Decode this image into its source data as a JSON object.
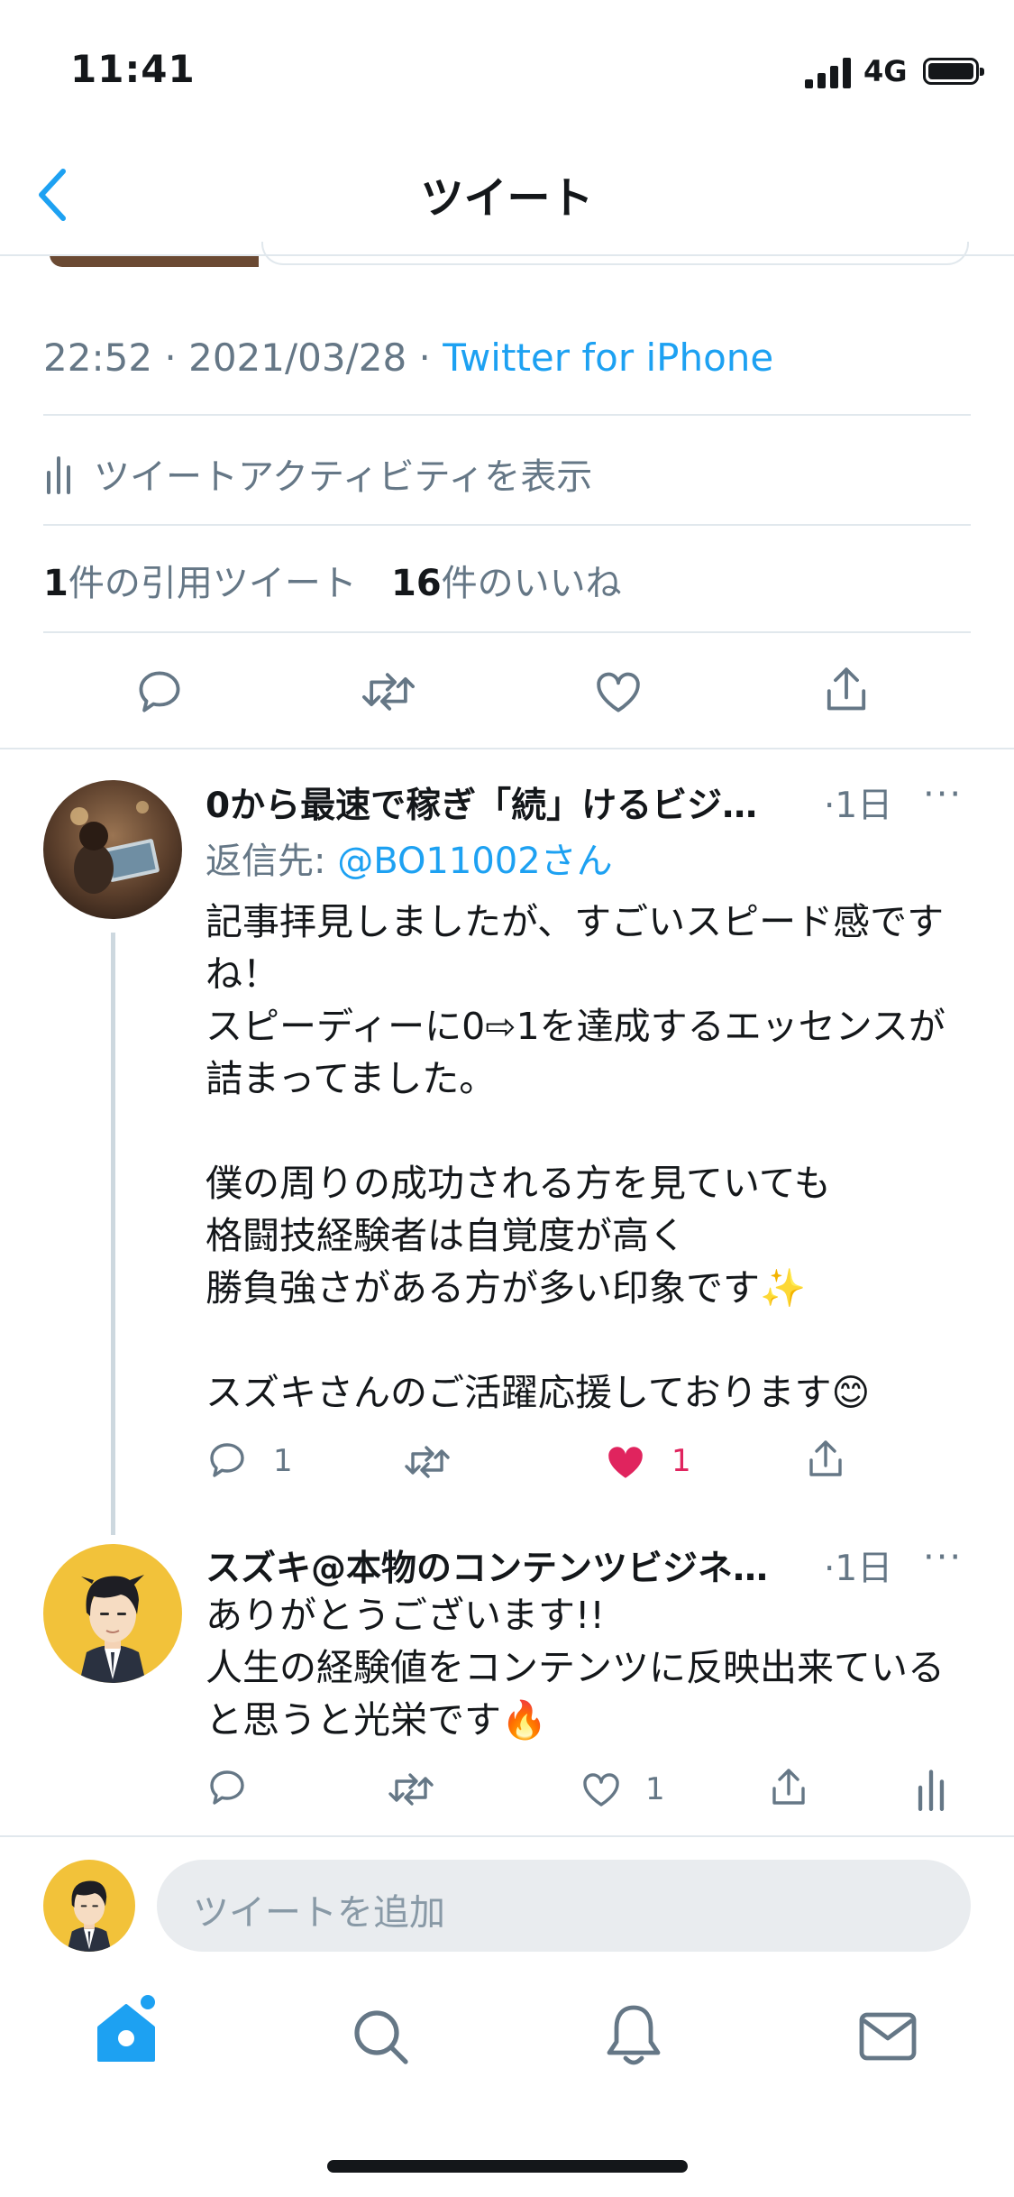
{
  "status_bar": {
    "time": "11:41",
    "network": "4G"
  },
  "nav": {
    "title": "ツイート"
  },
  "tweet_meta": {
    "time": "22:52",
    "sep1": " · ",
    "date": "2021/03/28",
    "sep2": " · ",
    "client": "Twitter for iPhone"
  },
  "activity": {
    "label": "ツイートアクティビティを表示"
  },
  "stats": {
    "quote_count": "1",
    "quote_label": "件の引用ツイート",
    "like_count": "16",
    "like_label": "件のいいね"
  },
  "replies": [
    {
      "name": "0から最速で稼ぎ「続」けるビジ…",
      "date": "·1日",
      "more": "···",
      "reply_prefix": "返信先: ",
      "reply_handle": "@BO11002さん",
      "text": "記事拝見しましたが、すごいスピード感ですね！\nスピーディーに0⇨1を達成するエッセンスが詰まってました。\n\n僕の周りの成功される方を見ていても\n格闘技経験者は自覚度が高く\n勝負強さがある方が多い印象です✨\n\nスズキさんのご活躍応援しております😊",
      "reply_count": "1",
      "like_count": "1"
    },
    {
      "name": "スズキ@本物のコンテンツビジネ…",
      "date": "·1日",
      "more": "···",
      "text": "ありがとうございます!!\n人生の経験値をコンテンツに反映出来ていると思うと光栄です🔥",
      "like_count": "1"
    }
  ],
  "compose": {
    "placeholder": "ツイートを追加"
  },
  "colors": {
    "accent": "#1da1f2",
    "like_red": "#e0245e",
    "secondary_text": "#657786",
    "divider": "#e1e8ed"
  },
  "icons": [
    "signal-icon",
    "battery-icon",
    "back-chevron-icon",
    "activity-chart-icon",
    "reply-icon",
    "retweet-icon",
    "like-icon",
    "share-icon",
    "home-icon",
    "search-icon",
    "notifications-icon",
    "messages-icon"
  ]
}
